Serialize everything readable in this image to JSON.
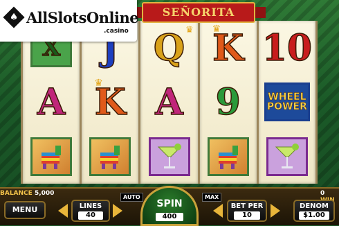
{
  "logo": {
    "title": "AllSlotsOnline",
    "sub": ".casino",
    "suit": "♠"
  },
  "game": {
    "title": "SEÑORITA"
  },
  "reels": [
    [
      {
        "type": "x",
        "label": "X"
      },
      {
        "type": "letter",
        "label": "A",
        "color": "#c0267a"
      },
      {
        "type": "pinata",
        "icon": "pinata-icon"
      }
    ],
    [
      {
        "type": "letter",
        "label": "J",
        "color": "#1d3fbf"
      },
      {
        "type": "letter",
        "label": "K",
        "color": "#e05a1a",
        "crown": true
      },
      {
        "type": "pinata",
        "icon": "pinata-icon"
      }
    ],
    [
      {
        "type": "letter",
        "label": "Q",
        "color": "#d9a21a",
        "crown": true
      },
      {
        "type": "letter",
        "label": "A",
        "color": "#c0267a"
      },
      {
        "type": "margarita",
        "icon": "margarita-icon"
      }
    ],
    [
      {
        "type": "letter",
        "label": "K",
        "color": "#e05a1a",
        "crown": true
      },
      {
        "type": "letter",
        "label": "9",
        "color": "#2a9a3a"
      },
      {
        "type": "pinata",
        "icon": "pinata-icon"
      }
    ],
    [
      {
        "type": "letter",
        "label": "10",
        "color": "#c81d1d"
      },
      {
        "type": "wheel",
        "label1": "WHEEL",
        "label2": "POWER"
      },
      {
        "type": "margarita",
        "icon": "margarita-icon"
      }
    ]
  ],
  "status": {
    "balance_label": "BALANCE",
    "balance_value": "5,000",
    "win_value": "0",
    "win_label": "WIN"
  },
  "controls": {
    "menu": "MENU",
    "lines_label": "LINES",
    "lines_value": "40",
    "auto": "AUTO",
    "max": "MAX",
    "spin_label": "SPIN",
    "spin_value": "400",
    "bet_label": "BET PER",
    "bet_value": "10",
    "denom_label": "DENOM",
    "denom_value": "$1.00"
  },
  "colors": {
    "accent": "#e8b53a",
    "felt": "#1d5a2a"
  }
}
